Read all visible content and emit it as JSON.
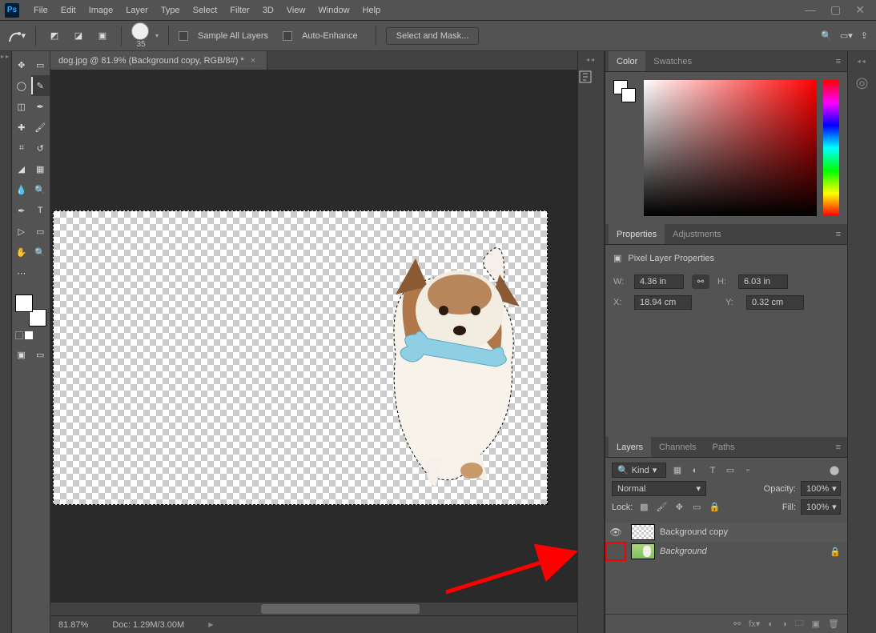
{
  "menubar": {
    "items": [
      "File",
      "Edit",
      "Image",
      "Layer",
      "Type",
      "Select",
      "Filter",
      "3D",
      "View",
      "Window",
      "Help"
    ]
  },
  "options": {
    "brush_size": "35",
    "sample_all": "Sample All Layers",
    "auto_enhance": "Auto-Enhance",
    "select_mask": "Select and Mask..."
  },
  "doc_tab": "dog.jpg @ 81.9% (Background copy, RGB/8#) *",
  "status": {
    "zoom": "81.87%",
    "doc": "Doc: 1.29M/3.00M"
  },
  "panels": {
    "color": {
      "tabs": [
        "Color",
        "Swatches"
      ],
      "active": 0
    },
    "properties": {
      "tabs": [
        "Properties",
        "Adjustments"
      ],
      "active": 0,
      "title": "Pixel Layer Properties",
      "w_label": "W:",
      "w": "4.36 in",
      "h_label": "H:",
      "h": "6.03 in",
      "x_label": "X:",
      "x": "18.94 cm",
      "y_label": "Y:",
      "y": "0.32 cm"
    },
    "layers": {
      "tabs": [
        "Layers",
        "Channels",
        "Paths"
      ],
      "active": 0,
      "kind": "Kind",
      "blend": "Normal",
      "opacity_label": "Opacity:",
      "opacity": "100%",
      "lock_label": "Lock:",
      "fill_label": "Fill:",
      "fill": "100%",
      "rows": [
        {
          "name": "Background copy",
          "visible": true,
          "italic": false,
          "locked": false,
          "selected": true
        },
        {
          "name": "Background",
          "visible": false,
          "italic": true,
          "locked": true,
          "selected": false
        }
      ]
    }
  },
  "chart_data": null
}
